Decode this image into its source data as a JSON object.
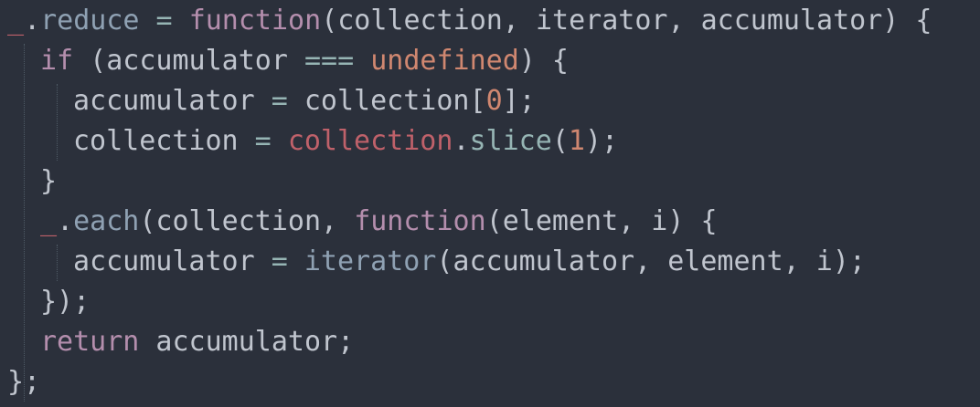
{
  "colors": {
    "background": "#2b303b",
    "text": "#c0c5ce",
    "function_name": "#8fa1b3",
    "keyword": "#b48ead",
    "variable": "#bf616a",
    "number": "#d08770",
    "operator": "#96b5b4"
  },
  "code": {
    "l1": {
      "t1": "_",
      "t2": ".",
      "t3": "reduce",
      "t4": " = ",
      "t5": "function",
      "t6": "(collection, iterator, accumulator) {"
    },
    "l2": {
      "t1": "if",
      "t2": " (accumulator ",
      "t3": "===",
      "t4": " ",
      "t5": "undefined",
      "t6": ") {"
    },
    "l3": {
      "t1": "accumulator",
      "t2": " = ",
      "t3": "collection[",
      "t4": "0",
      "t5": "];"
    },
    "l4": {
      "t1": "collection",
      "t2": " = ",
      "t3": "collection",
      "t4": ".",
      "t5": "slice",
      "t6": "(",
      "t7": "1",
      "t8": ");"
    },
    "l5": {
      "t1": "}"
    },
    "l6": {
      "t1": "_",
      "t2": ".",
      "t3": "each",
      "t4": "(collection, ",
      "t5": "function",
      "t6": "(element, i) {"
    },
    "l7": {
      "t1": "accumulator",
      "t2": " = ",
      "t3": "iterator",
      "t4": "(accumulator, element, i);"
    },
    "l8": {
      "t1": "});"
    },
    "l9": {
      "t1": "return",
      "t2": " accumulator;"
    },
    "l10": {
      "t1": "};"
    }
  }
}
